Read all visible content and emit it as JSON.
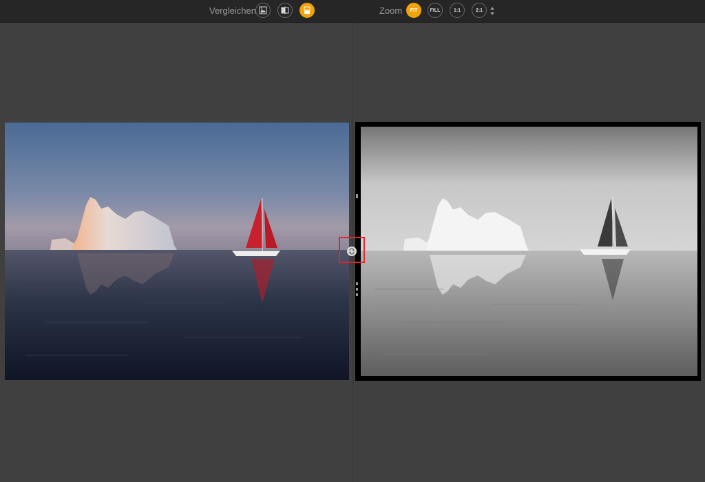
{
  "toolbar": {
    "compare_label": "Vergleichen",
    "compare_buttons": [
      {
        "icon": "image-compare-icon",
        "active": false
      },
      {
        "icon": "split-view-icon",
        "active": false
      },
      {
        "icon": "side-by-side-icon",
        "active": true
      }
    ],
    "zoom_label": "Zoom",
    "zoom_buttons": [
      {
        "label": "FIT",
        "active": true
      },
      {
        "label": "FILL",
        "active": false
      },
      {
        "label": "1:1",
        "active": false
      },
      {
        "label": "2:1",
        "active": false
      }
    ]
  },
  "panels": {
    "left": {
      "icon": "color-photo-original"
    },
    "right": {
      "icon": "black-and-white-photo-edited"
    }
  },
  "swap_button": {
    "icon": "swap-icon"
  },
  "colors": {
    "accent": "#f0a30a",
    "toolbar_bg": "#262626",
    "workspace_bg": "#404040",
    "highlight": "#e0262a"
  }
}
